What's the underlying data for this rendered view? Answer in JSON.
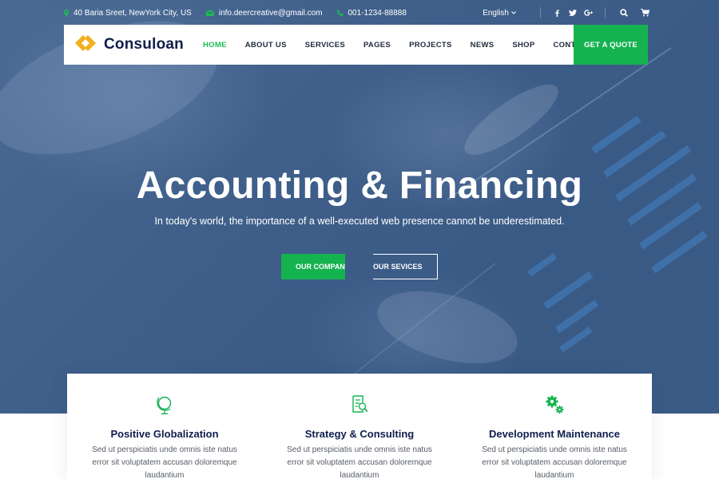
{
  "colors": {
    "accent": "#15b250",
    "navy": "#0e1f4d",
    "logo_gold": "#f2b01e",
    "hero_overlay": "#3f5f8a"
  },
  "topbar": {
    "address": {
      "icon": "map-pin-icon",
      "text": "40 Baria Sreet, NewYork City, US"
    },
    "email": {
      "icon": "envelope-icon",
      "text": "info.deercreative@gmail.com"
    },
    "phone": {
      "icon": "phone-icon",
      "text": "001-1234-88888"
    },
    "language": {
      "label": "English",
      "icon": "chevron-down-icon"
    },
    "social": [
      {
        "name": "facebook",
        "glyph": "f"
      },
      {
        "name": "twitter",
        "glyph": "t"
      },
      {
        "name": "google-plus",
        "glyph": "G+"
      }
    ],
    "tools": [
      {
        "name": "search",
        "icon": "search-icon"
      },
      {
        "name": "cart",
        "icon": "cart-icon"
      }
    ]
  },
  "nav": {
    "logo_text": "Consuloan",
    "items": [
      {
        "label": "HOME",
        "active": true
      },
      {
        "label": "ABOUT US",
        "active": false
      },
      {
        "label": "SERVICES",
        "active": false
      },
      {
        "label": "PAGES",
        "active": false
      },
      {
        "label": "PROJECTS",
        "active": false
      },
      {
        "label": "NEWS",
        "active": false
      },
      {
        "label": "SHOP",
        "active": false
      },
      {
        "label": "CONTACT",
        "active": false
      }
    ],
    "cta_label": "GET A QUOTE"
  },
  "hero": {
    "title": "Accounting & Financing",
    "subtitle": "In today's world, the importance of a well-executed web presence cannot be underestimated.",
    "primary_button": "OUR COMPANY",
    "secondary_button": "OUR SEVICES"
  },
  "features": [
    {
      "icon": "globe-icon",
      "title": "Positive Globalization",
      "desc": "Sed ut perspiciatis unde omnis iste natus error sit voluptatem accusan doloremque laudantium"
    },
    {
      "icon": "document-search-icon",
      "title": "Strategy & Consulting",
      "desc": "Sed ut perspiciatis unde omnis iste natus error sit voluptatem accusan doloremque laudantium"
    },
    {
      "icon": "gears-icon",
      "title": "Development Maintenance",
      "desc": "Sed ut perspiciatis unde omnis iste natus error sit voluptatem accusan doloremque laudantium"
    }
  ]
}
